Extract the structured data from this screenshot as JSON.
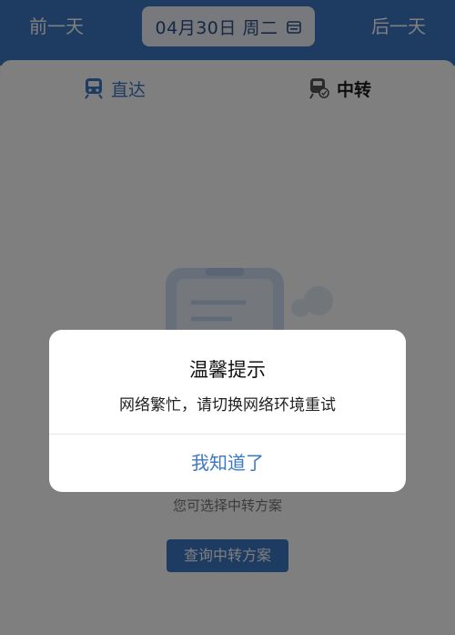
{
  "header": {
    "prev_day": "前一天",
    "date": "04月30日 周二",
    "next_day": "后一天"
  },
  "tabs": [
    {
      "label": "直达",
      "icon": "train-icon",
      "active": false
    },
    {
      "label": "中转",
      "icon": "transfer-train-icon",
      "active": true
    }
  ],
  "content": {
    "hint": "您可选择中转方案",
    "query_button": "查询中转方案"
  },
  "dialog": {
    "title": "温馨提示",
    "message": "网络繁忙，请切换网络环境重试",
    "confirm": "我知道了"
  },
  "colors": {
    "accent": "#3d78c4",
    "overlay": "rgba(0,0,0,0.5)"
  }
}
